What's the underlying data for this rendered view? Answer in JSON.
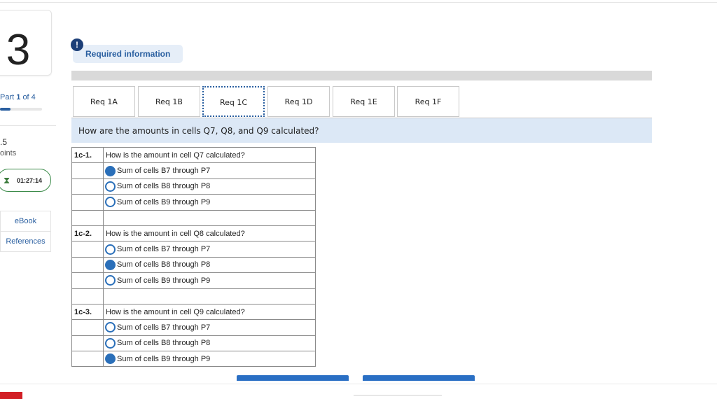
{
  "question": {
    "number": "3",
    "part_label_prefix": "Part",
    "part_current": "1",
    "part_of": "of 4",
    "part_progress": 0.25,
    "points_value": ".5",
    "points_label": "oints",
    "timer": "01:27:14",
    "timer_icon": "hourglass-icon"
  },
  "sidebar": {
    "ebook": "eBook",
    "references": "References"
  },
  "required_info": {
    "icon": "!",
    "label": "Required information"
  },
  "tabs": [
    {
      "label": "Req 1A",
      "active": false
    },
    {
      "label": "Req 1B",
      "active": false
    },
    {
      "label": "Req 1C",
      "active": true
    },
    {
      "label": "Req 1D",
      "active": false
    },
    {
      "label": "Req 1E",
      "active": false
    },
    {
      "label": "Req 1F",
      "active": false
    }
  ],
  "prompt": "How are the amounts in cells Q7, Q8, and Q9 calculated?",
  "items": [
    {
      "id": "1c-1.",
      "question": "How is the amount in cell Q7 calculated?",
      "options": [
        {
          "label": "Sum of cells B7 through P7",
          "selected": true
        },
        {
          "label": "Sum of cells B8 through P8",
          "selected": false
        },
        {
          "label": "Sum of cells B9 through P9",
          "selected": false
        }
      ]
    },
    {
      "id": "1c-2.",
      "question": "How is the amount in cell Q8 calculated?",
      "options": [
        {
          "label": "Sum of cells B7 through P7",
          "selected": false
        },
        {
          "label": "Sum of cells B8 through P8",
          "selected": true
        },
        {
          "label": "Sum of cells B9 through P9",
          "selected": false
        }
      ]
    },
    {
      "id": "1c-3.",
      "question": "How is the amount in cell Q9 calculated?",
      "options": [
        {
          "label": "Sum of cells B7 through P7",
          "selected": false
        },
        {
          "label": "Sum of cells B8 through P8",
          "selected": false
        },
        {
          "label": "Sum of cells B9 through P9",
          "selected": true
        }
      ]
    }
  ],
  "colors": {
    "accent": "#2a6fb9",
    "banner": "#dce8f6",
    "brand_logo": "#d21f26"
  }
}
